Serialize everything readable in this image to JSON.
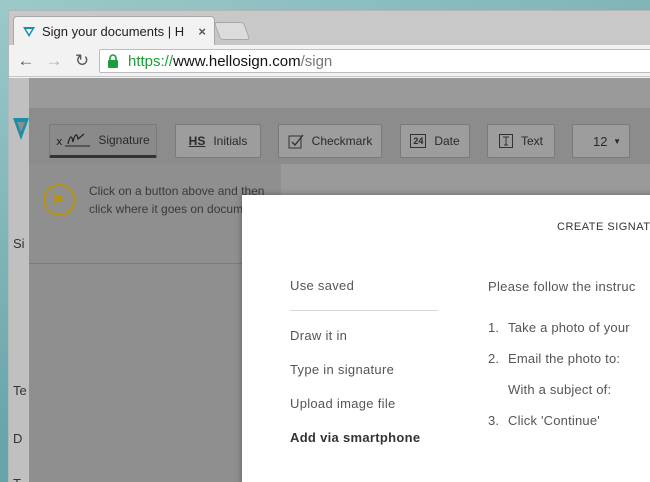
{
  "browser": {
    "tab_title": "Sign your documents | H",
    "tab_close": "×",
    "url_scheme": "https://",
    "url_host": "www.hellosign.com",
    "url_path": "/sign",
    "back_glyph": "←",
    "forward_glyph": "→",
    "reload_glyph": "↻"
  },
  "editor": {
    "tools": [
      {
        "label": "Signature",
        "icon": "signature-icon",
        "active": true
      },
      {
        "label": "Initials",
        "icon": "initials-icon",
        "active": false
      },
      {
        "label": "Checkmark",
        "icon": "checkmark-icon",
        "active": false
      },
      {
        "label": "Date",
        "icon": "date-icon",
        "active": false
      },
      {
        "label": "Text",
        "icon": "text-icon",
        "active": false
      }
    ],
    "initials_badge": "HS",
    "date_badge": "24",
    "font_size": "12",
    "hint": "Click on a button above and then click where it goes on document.",
    "side_letters": [
      "Si",
      "Te",
      "D",
      "T"
    ]
  },
  "modal": {
    "title": "CREATE SIGNAT",
    "menu": [
      {
        "label": "Use saved",
        "selected": false
      },
      {
        "label": "Draw it in",
        "selected": false
      },
      {
        "label": "Type in signature",
        "selected": false
      },
      {
        "label": "Upload image file",
        "selected": false
      },
      {
        "label": "Add via smartphone",
        "selected": true
      }
    ],
    "intro": "Please follow the instruc",
    "steps": [
      {
        "num": "1.",
        "text": "Take a photo of your"
      },
      {
        "num": "2.",
        "text": "Email the photo to:"
      },
      {
        "num": "",
        "text": "With a subject of:"
      },
      {
        "num": "3.",
        "text": "Click 'Continue'"
      }
    ]
  },
  "colors": {
    "accent_teal": "#1a90a8",
    "url_green": "#1a9e3a",
    "hint_icon": "#b8920f"
  }
}
